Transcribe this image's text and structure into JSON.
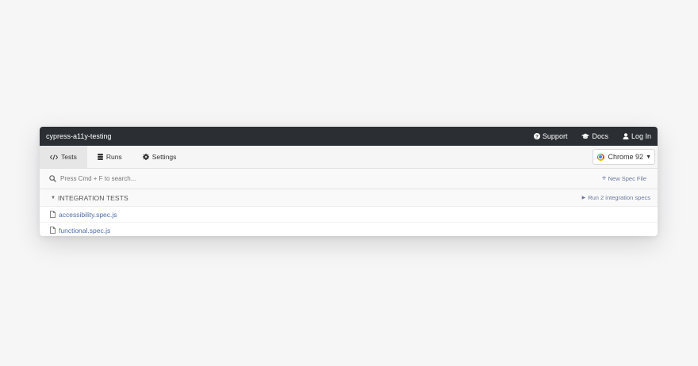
{
  "app": {
    "title": "cypress-a11y-testing"
  },
  "top_links": [
    {
      "icon": "question-circle-icon",
      "label": "Support"
    },
    {
      "icon": "graduation-cap-icon",
      "label": "Docs"
    },
    {
      "icon": "user-icon",
      "label": "Log In"
    }
  ],
  "tabs": [
    {
      "icon": "code-icon",
      "label": "Tests",
      "active": true
    },
    {
      "icon": "database-icon",
      "label": "Runs",
      "active": false
    },
    {
      "icon": "gear-icon",
      "label": "Settings",
      "active": false
    }
  ],
  "browser": {
    "icon": "chrome-icon",
    "label": "Chrome 92"
  },
  "search": {
    "placeholder": "Press Cmd + F to search...",
    "value": ""
  },
  "new_spec": {
    "label": "New Spec File"
  },
  "group": {
    "label": "INTEGRATION TESTS",
    "run_label": "Run 2 integration specs",
    "specs": [
      {
        "icon": "file-icon",
        "name": "accessibility.spec.js"
      },
      {
        "icon": "file-icon",
        "name": "functional.spec.js"
      }
    ]
  },
  "colors": {
    "titlebar_bg": "#2b2e33",
    "link_blue": "#4f6ca8",
    "muted_link": "#6c7a9c",
    "page_bg": "#f6f6f7"
  }
}
